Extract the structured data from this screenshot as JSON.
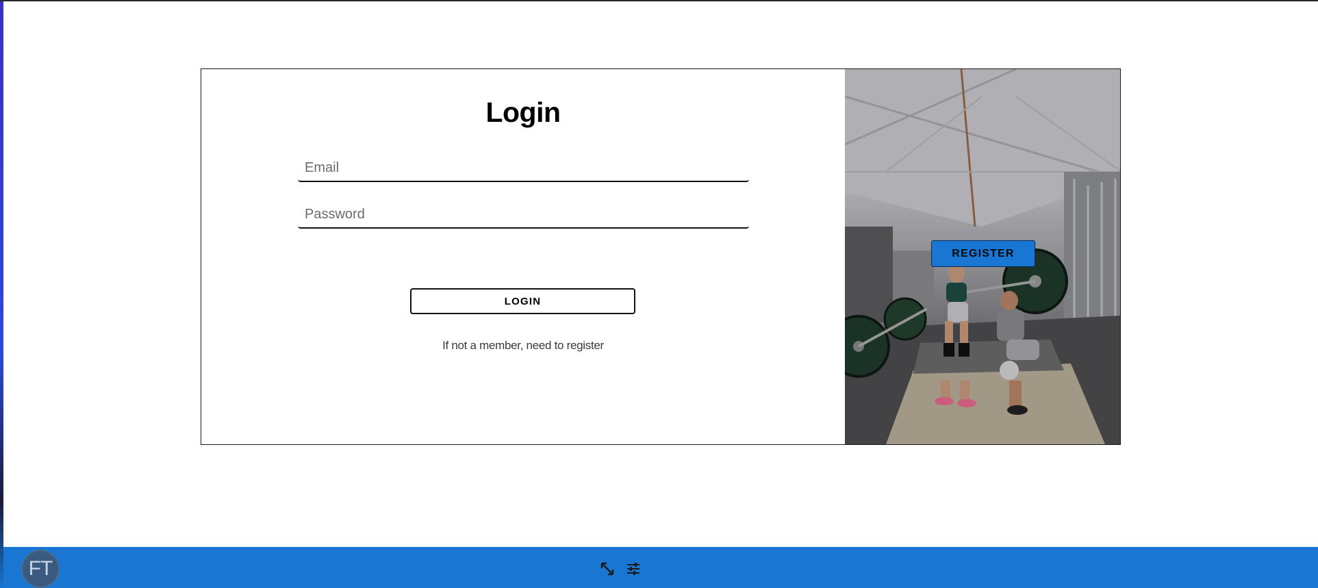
{
  "login_form": {
    "title": "Login",
    "email_placeholder": "Email",
    "password_placeholder": "Password",
    "login_label": "LOGIN",
    "register_hint": "If not a member, need to register"
  },
  "hero": {
    "register_label": "REGISTER"
  },
  "bottom_bar": {
    "avatar_initials": "FT",
    "icons": [
      "expand-icon",
      "tune-icon"
    ]
  },
  "colors": {
    "accent": "#1976d2",
    "text": "#000000",
    "hint_text": "#3a3a3a"
  }
}
